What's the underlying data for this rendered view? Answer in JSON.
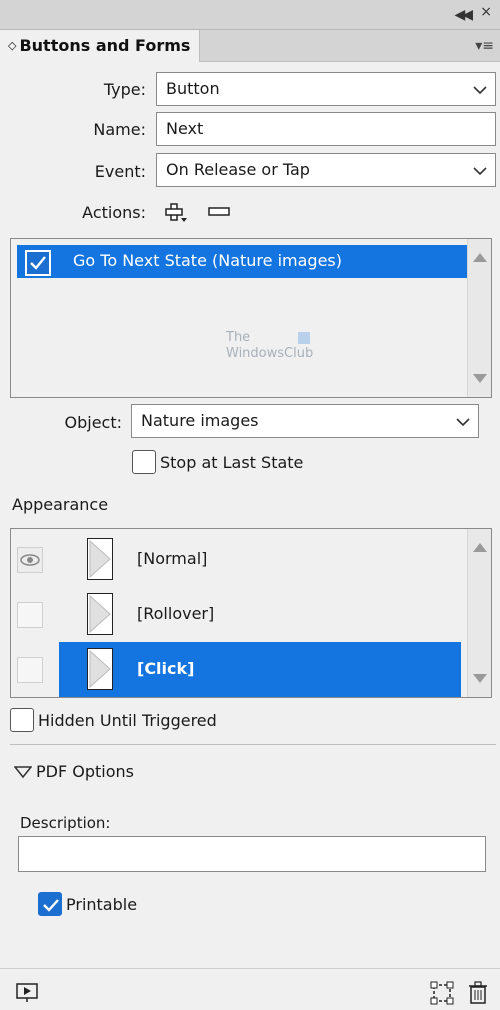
{
  "panel": {
    "title": "Buttons and Forms",
    "tab_arrows_icon": "up-down-arrows-icon",
    "menu_icon": "panel-menu-icon"
  },
  "form": {
    "type_label": "Type:",
    "type_value": "Button",
    "name_label": "Name:",
    "name_value": "Next",
    "event_label": "Event:",
    "event_value": "On Release or Tap",
    "actions_label": "Actions:"
  },
  "actions_list": {
    "items": [
      {
        "label": "Go To Next State (Nature images)",
        "checked": true,
        "selected": true
      }
    ]
  },
  "watermark": {
    "line1": "The",
    "line2": "WindowsClub"
  },
  "object": {
    "label": "Object:",
    "value": "Nature images",
    "stop_label": "Stop at Last State"
  },
  "appearance": {
    "title": "Appearance",
    "states": [
      {
        "label": "[Normal]",
        "visible": true,
        "selected": false
      },
      {
        "label": "[Rollover]",
        "visible": false,
        "selected": false
      },
      {
        "label": "[Click]",
        "visible": false,
        "selected": true
      }
    ],
    "hidden_label": "Hidden Until Triggered"
  },
  "pdf": {
    "title": "PDF Options",
    "description_label": "Description:",
    "description_value": "",
    "printable_label": "Printable",
    "printable_checked": true
  },
  "colors": {
    "selection": "#1474e0",
    "panel_bg": "#f0f0f0",
    "tab_bar": "#d4d4d4"
  }
}
